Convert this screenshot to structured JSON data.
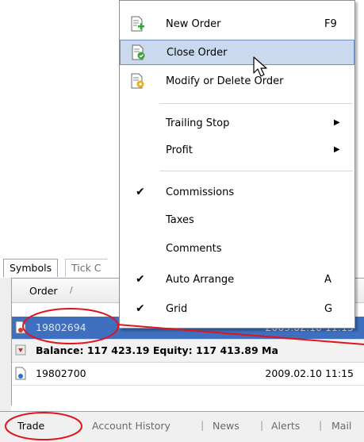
{
  "tabs_top": {
    "symbols": "Symbols",
    "tick_chart": "Tick C"
  },
  "grid": {
    "columns": {
      "order": "Order",
      "sort_glyph": "/"
    },
    "rows": [
      {
        "order": "19802694",
        "time": "2009.02.10 11:15"
      },
      {
        "order": "19802700",
        "time": "2009.02.10 11:15"
      }
    ],
    "balance_line": "Balance: 117 423.19  Equity: 117 413.89  Ma"
  },
  "bottom_tabs": [
    "Trade",
    "Account History",
    "News",
    "Alerts",
    "Mail"
  ],
  "menu": {
    "new_order": {
      "label": "New Order",
      "shortcut": "F9"
    },
    "close_order": {
      "label": "Close Order"
    },
    "modify_order": {
      "label": "Modify or Delete Order"
    },
    "trailing_stop": {
      "label": "Trailing Stop"
    },
    "profit": {
      "label": "Profit"
    },
    "commissions": {
      "label": "Commissions",
      "checked": true
    },
    "taxes": {
      "label": "Taxes",
      "checked": false
    },
    "comments": {
      "label": "Comments",
      "checked": false
    },
    "auto_arrange": {
      "label": "Auto Arrange",
      "shortcut": "A",
      "checked": true
    },
    "grid": {
      "label": "Grid",
      "shortcut": "G",
      "checked": true
    }
  },
  "colors": {
    "selection": "#3f6fbf",
    "menu_highlight": "#cad9ee",
    "annotation": "#e0141e"
  }
}
